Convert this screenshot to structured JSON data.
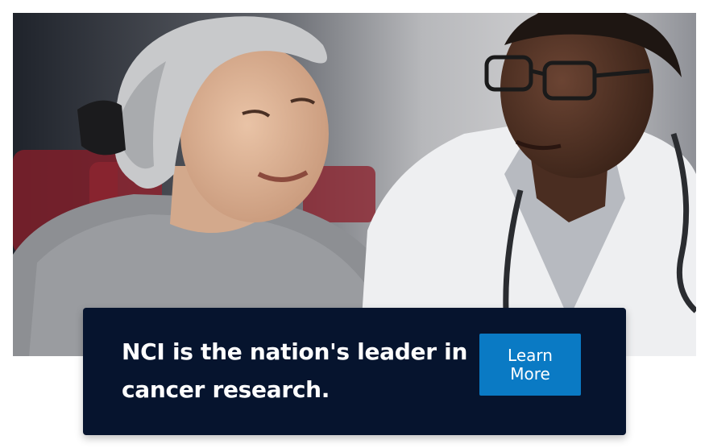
{
  "hero": {
    "image_alt": "Cancer patient wearing a head scarf smiling with a doctor in a white coat and stethoscope"
  },
  "callout": {
    "text": "NCI is the nation's leader in cancer research.",
    "button_label": "Learn More",
    "colors": {
      "panel": "#06142e",
      "button": "#0a7ac4",
      "text": "#ffffff"
    }
  }
}
